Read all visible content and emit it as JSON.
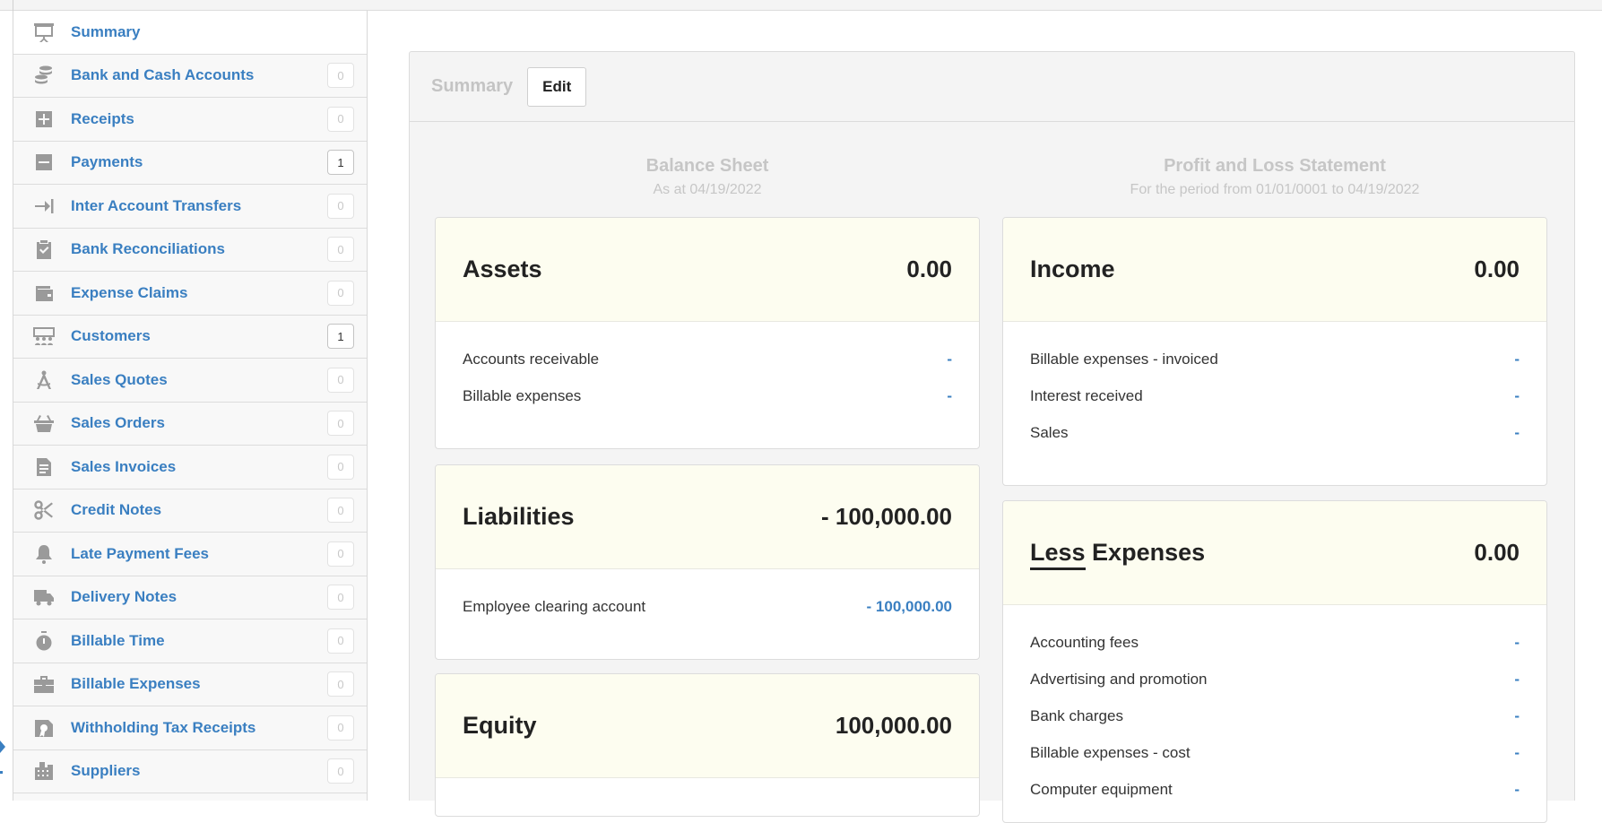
{
  "sidebar": {
    "items": [
      {
        "label": "Summary",
        "icon": "presentation-icon",
        "badge": ""
      },
      {
        "label": "Bank and Cash Accounts",
        "icon": "coins-icon",
        "badge": "0"
      },
      {
        "label": "Receipts",
        "icon": "plus-square-icon",
        "badge": "0"
      },
      {
        "label": "Payments",
        "icon": "minus-square-icon",
        "badge": "1"
      },
      {
        "label": "Inter Account Transfers",
        "icon": "transfer-arrow-icon",
        "badge": "0"
      },
      {
        "label": "Bank Reconciliations",
        "icon": "clipboard-check-icon",
        "badge": "0"
      },
      {
        "label": "Expense Claims",
        "icon": "wallet-icon",
        "badge": "0"
      },
      {
        "label": "Customers",
        "icon": "people-icon",
        "badge": "1"
      },
      {
        "label": "Sales Quotes",
        "icon": "compass-icon",
        "badge": "0"
      },
      {
        "label": "Sales Orders",
        "icon": "basket-icon",
        "badge": "0"
      },
      {
        "label": "Sales Invoices",
        "icon": "document-icon",
        "badge": "0"
      },
      {
        "label": "Credit Notes",
        "icon": "scissors-icon",
        "badge": "0"
      },
      {
        "label": "Late Payment Fees",
        "icon": "bell-icon",
        "badge": "0"
      },
      {
        "label": "Delivery Notes",
        "icon": "truck-icon",
        "badge": "0"
      },
      {
        "label": "Billable Time",
        "icon": "stopwatch-icon",
        "badge": "0"
      },
      {
        "label": "Billable Expenses",
        "icon": "briefcase-icon",
        "badge": "0"
      },
      {
        "label": "Withholding Tax Receipts",
        "icon": "certificate-icon",
        "badge": "0"
      },
      {
        "label": "Suppliers",
        "icon": "building-icon",
        "badge": "0"
      }
    ]
  },
  "panel": {
    "title": "Summary",
    "edit_label": "Edit"
  },
  "balance_sheet": {
    "title": "Balance Sheet",
    "subtitle": "As at 04/19/2022",
    "assets": {
      "title": "Assets",
      "total": "0.00",
      "rows": [
        {
          "label": "Accounts receivable",
          "value": "-"
        },
        {
          "label": "Billable expenses",
          "value": "-"
        }
      ]
    },
    "liabilities": {
      "title": "Liabilities",
      "total": "- 100,000.00",
      "rows": [
        {
          "label": "Employee clearing account",
          "value": "- 100,000.00"
        }
      ]
    },
    "equity": {
      "title": "Equity",
      "total": "100,000.00"
    }
  },
  "profit_loss": {
    "title": "Profit and Loss Statement",
    "subtitle": "For the period from 01/01/0001 to 04/19/2022",
    "income": {
      "title": "Income",
      "total": "0.00",
      "rows": [
        {
          "label": "Billable expenses - invoiced",
          "value": "-"
        },
        {
          "label": "Interest received",
          "value": "-"
        },
        {
          "label": "Sales",
          "value": "-"
        }
      ]
    },
    "expenses": {
      "title_less": "Less",
      "title_rest": " Expenses",
      "total": "0.00",
      "rows": [
        {
          "label": "Accounting fees",
          "value": "-"
        },
        {
          "label": "Advertising and promotion",
          "value": "-"
        },
        {
          "label": "Bank charges",
          "value": "-"
        },
        {
          "label": "Billable expenses - cost",
          "value": "-"
        },
        {
          "label": "Computer equipment",
          "value": "-"
        }
      ]
    }
  },
  "colors": {
    "link": "#3a7fc1",
    "card_header": "#fdfdf0",
    "icon_gray": "#9a9a9a"
  }
}
